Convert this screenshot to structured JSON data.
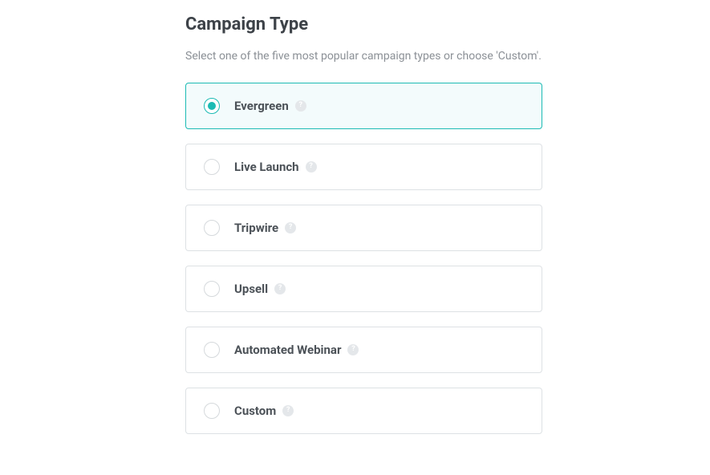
{
  "title": "Campaign Type",
  "subtitle": "Select one of the five most popular campaign types or choose 'Custom'.",
  "options": [
    {
      "label": "Evergreen",
      "selected": true
    },
    {
      "label": "Live Launch",
      "selected": false
    },
    {
      "label": "Tripwire",
      "selected": false
    },
    {
      "label": "Upsell",
      "selected": false
    },
    {
      "label": "Automated Webinar",
      "selected": false
    },
    {
      "label": "Custom",
      "selected": false
    }
  ],
  "helpGlyph": "?"
}
